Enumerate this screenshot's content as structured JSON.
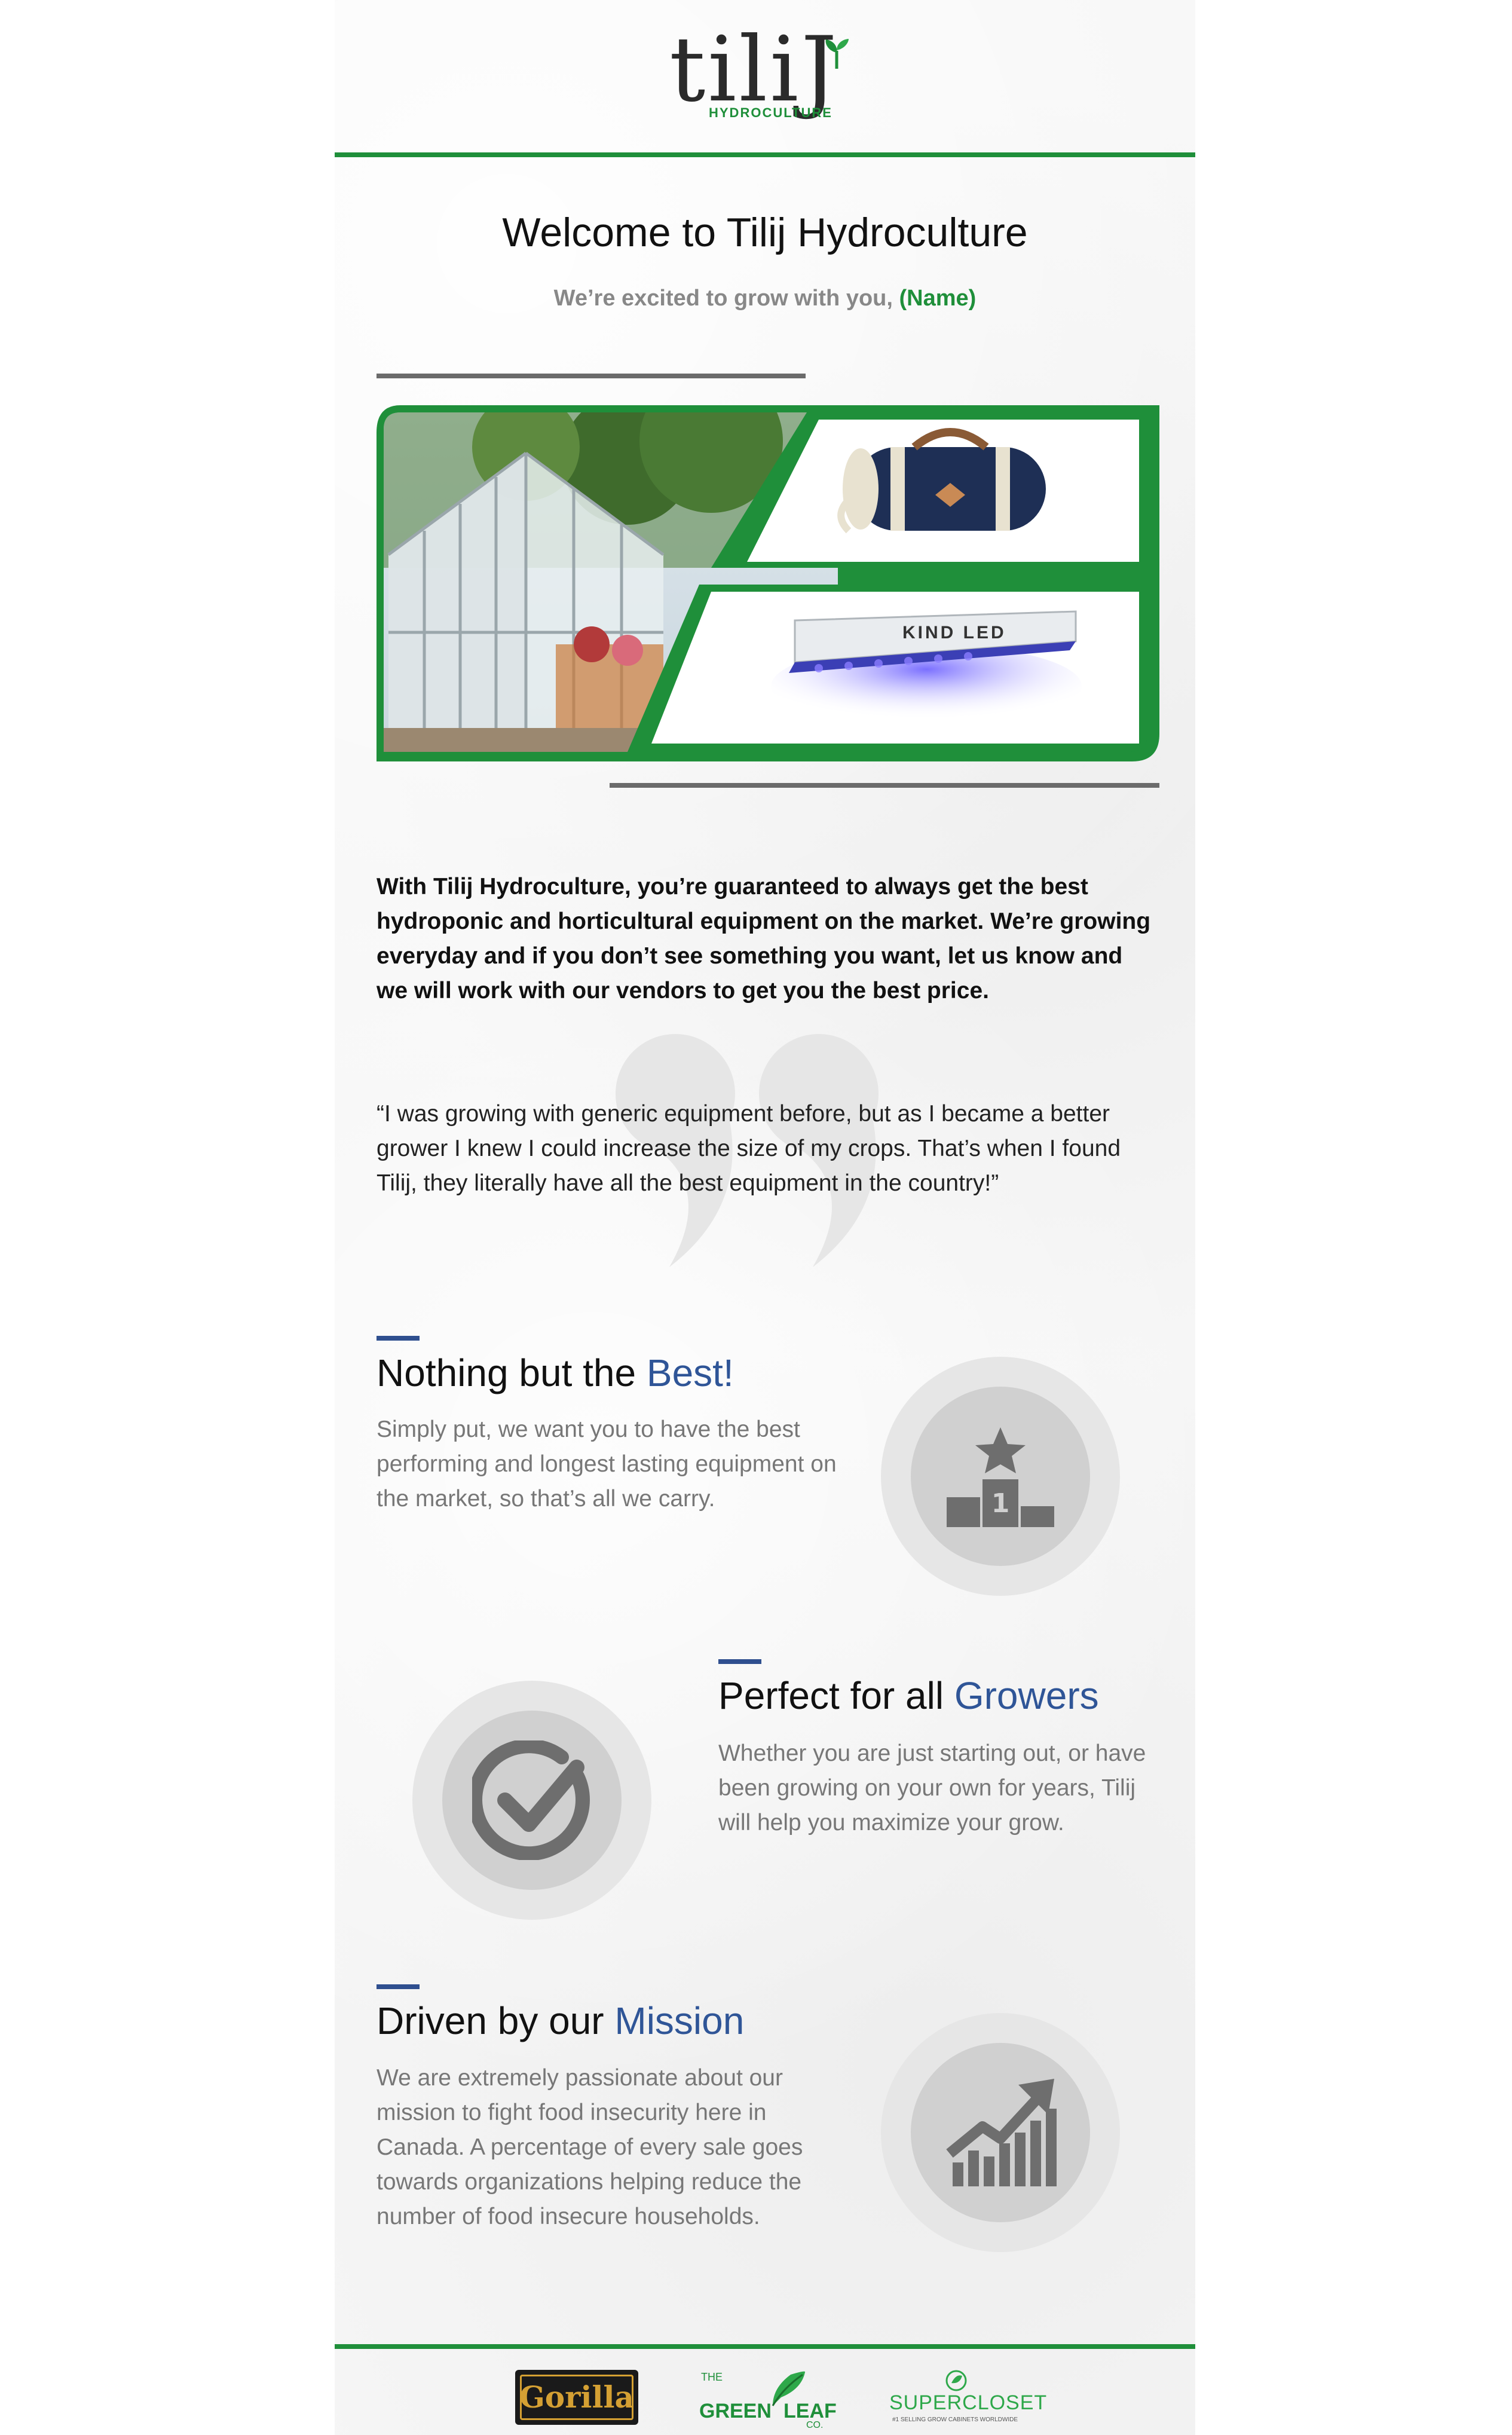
{
  "brand": {
    "logo_text": "tiliJ",
    "logo_sub": "HYDROCULTURE",
    "green": "#1f8f3a",
    "blue": "#2f5597"
  },
  "header": {
    "title": "Welcome to Tilij Hydroculture",
    "subtitle": "We’re excited to grow with you,",
    "name_token": "(Name)"
  },
  "hero": {
    "images": [
      "greenhouse",
      "duffel-bag",
      "kind-led-light"
    ],
    "led_label": "KIND LED"
  },
  "intro_text": "With Tilij Hydroculture, you’re guaranteed to always get the best hydroponic and horticultural equipment on the market. We’re growing everyday and if you don’t see something you want, let us know and we will work with our vendors to get you the best price.",
  "testimonial": "“I was growing with generic equipment before, but as I became a better grower I knew I could increase the size of my crops. That’s when I found Tilij, they literally have all the best equipment in the country!”",
  "sections": [
    {
      "title_lead": "Nothing but the",
      "title_highlight": "Best!",
      "body": "Simply put, we want you to have the best performing and longest lasting equipment on the market, so that’s all we carry.",
      "icon": "podium-icon"
    },
    {
      "title_lead": "Perfect for all",
      "title_highlight": "Growers",
      "body": "Whether you are just starting out, or have been growing on your own for years, Tilij will help you maximize your grow.",
      "icon": "checkmark-icon"
    },
    {
      "title_lead": "Driven by our",
      "title_highlight": "Mission",
      "body": "We are extremely passionate about our mission to fight food insecurity here in Canada. A percentage of every sale goes towards organizations helping reduce the number of food insecure households.",
      "icon": "growth-chart-icon"
    }
  ],
  "partners": [
    {
      "name": "Gorilla",
      "icon": "gorilla-logo"
    },
    {
      "name_top": "THE",
      "name_main": "GREEN",
      "name_side": "LEAF",
      "name_sub": "CO.",
      "icon": "green-leaf-logo"
    },
    {
      "name": "SUPERCLOSET",
      "tagline": "#1 SELLING GROW CABINETS WORLDWIDE",
      "icon": "supercloset-logo"
    }
  ]
}
